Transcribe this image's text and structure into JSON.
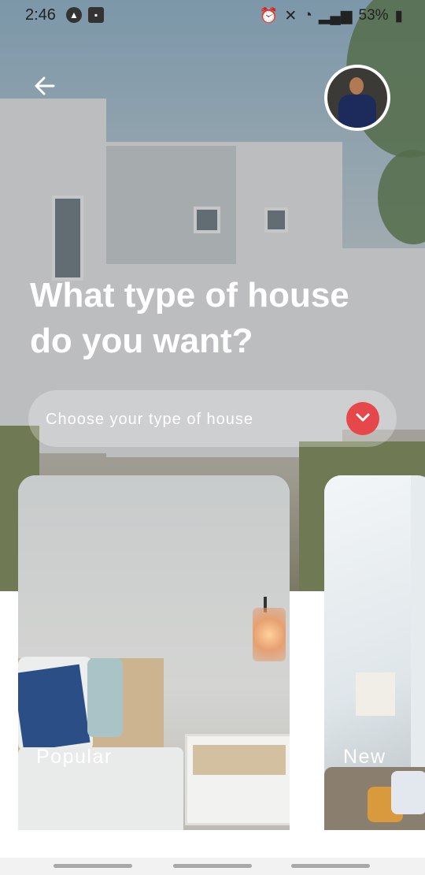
{
  "status_bar": {
    "time": "2:46",
    "battery": "53%",
    "icons": [
      "expo-icon",
      "voicemail-icon",
      "alarm-icon",
      "mute-icon",
      "wifi-icon",
      "signal-icon",
      "battery-icon"
    ]
  },
  "header": {
    "back_icon": "arrow-left-icon",
    "avatar_icon": "user-avatar"
  },
  "main": {
    "title": "What type of house do you want?",
    "select": {
      "placeholder": "Choose your type of house",
      "icon": "chevron-down-icon",
      "accent": "#e5474b"
    }
  },
  "categories": [
    {
      "label": "Popular"
    },
    {
      "label": "New"
    }
  ],
  "colors": {
    "accent": "#e5474b",
    "text_on_image": "#ffffff"
  }
}
